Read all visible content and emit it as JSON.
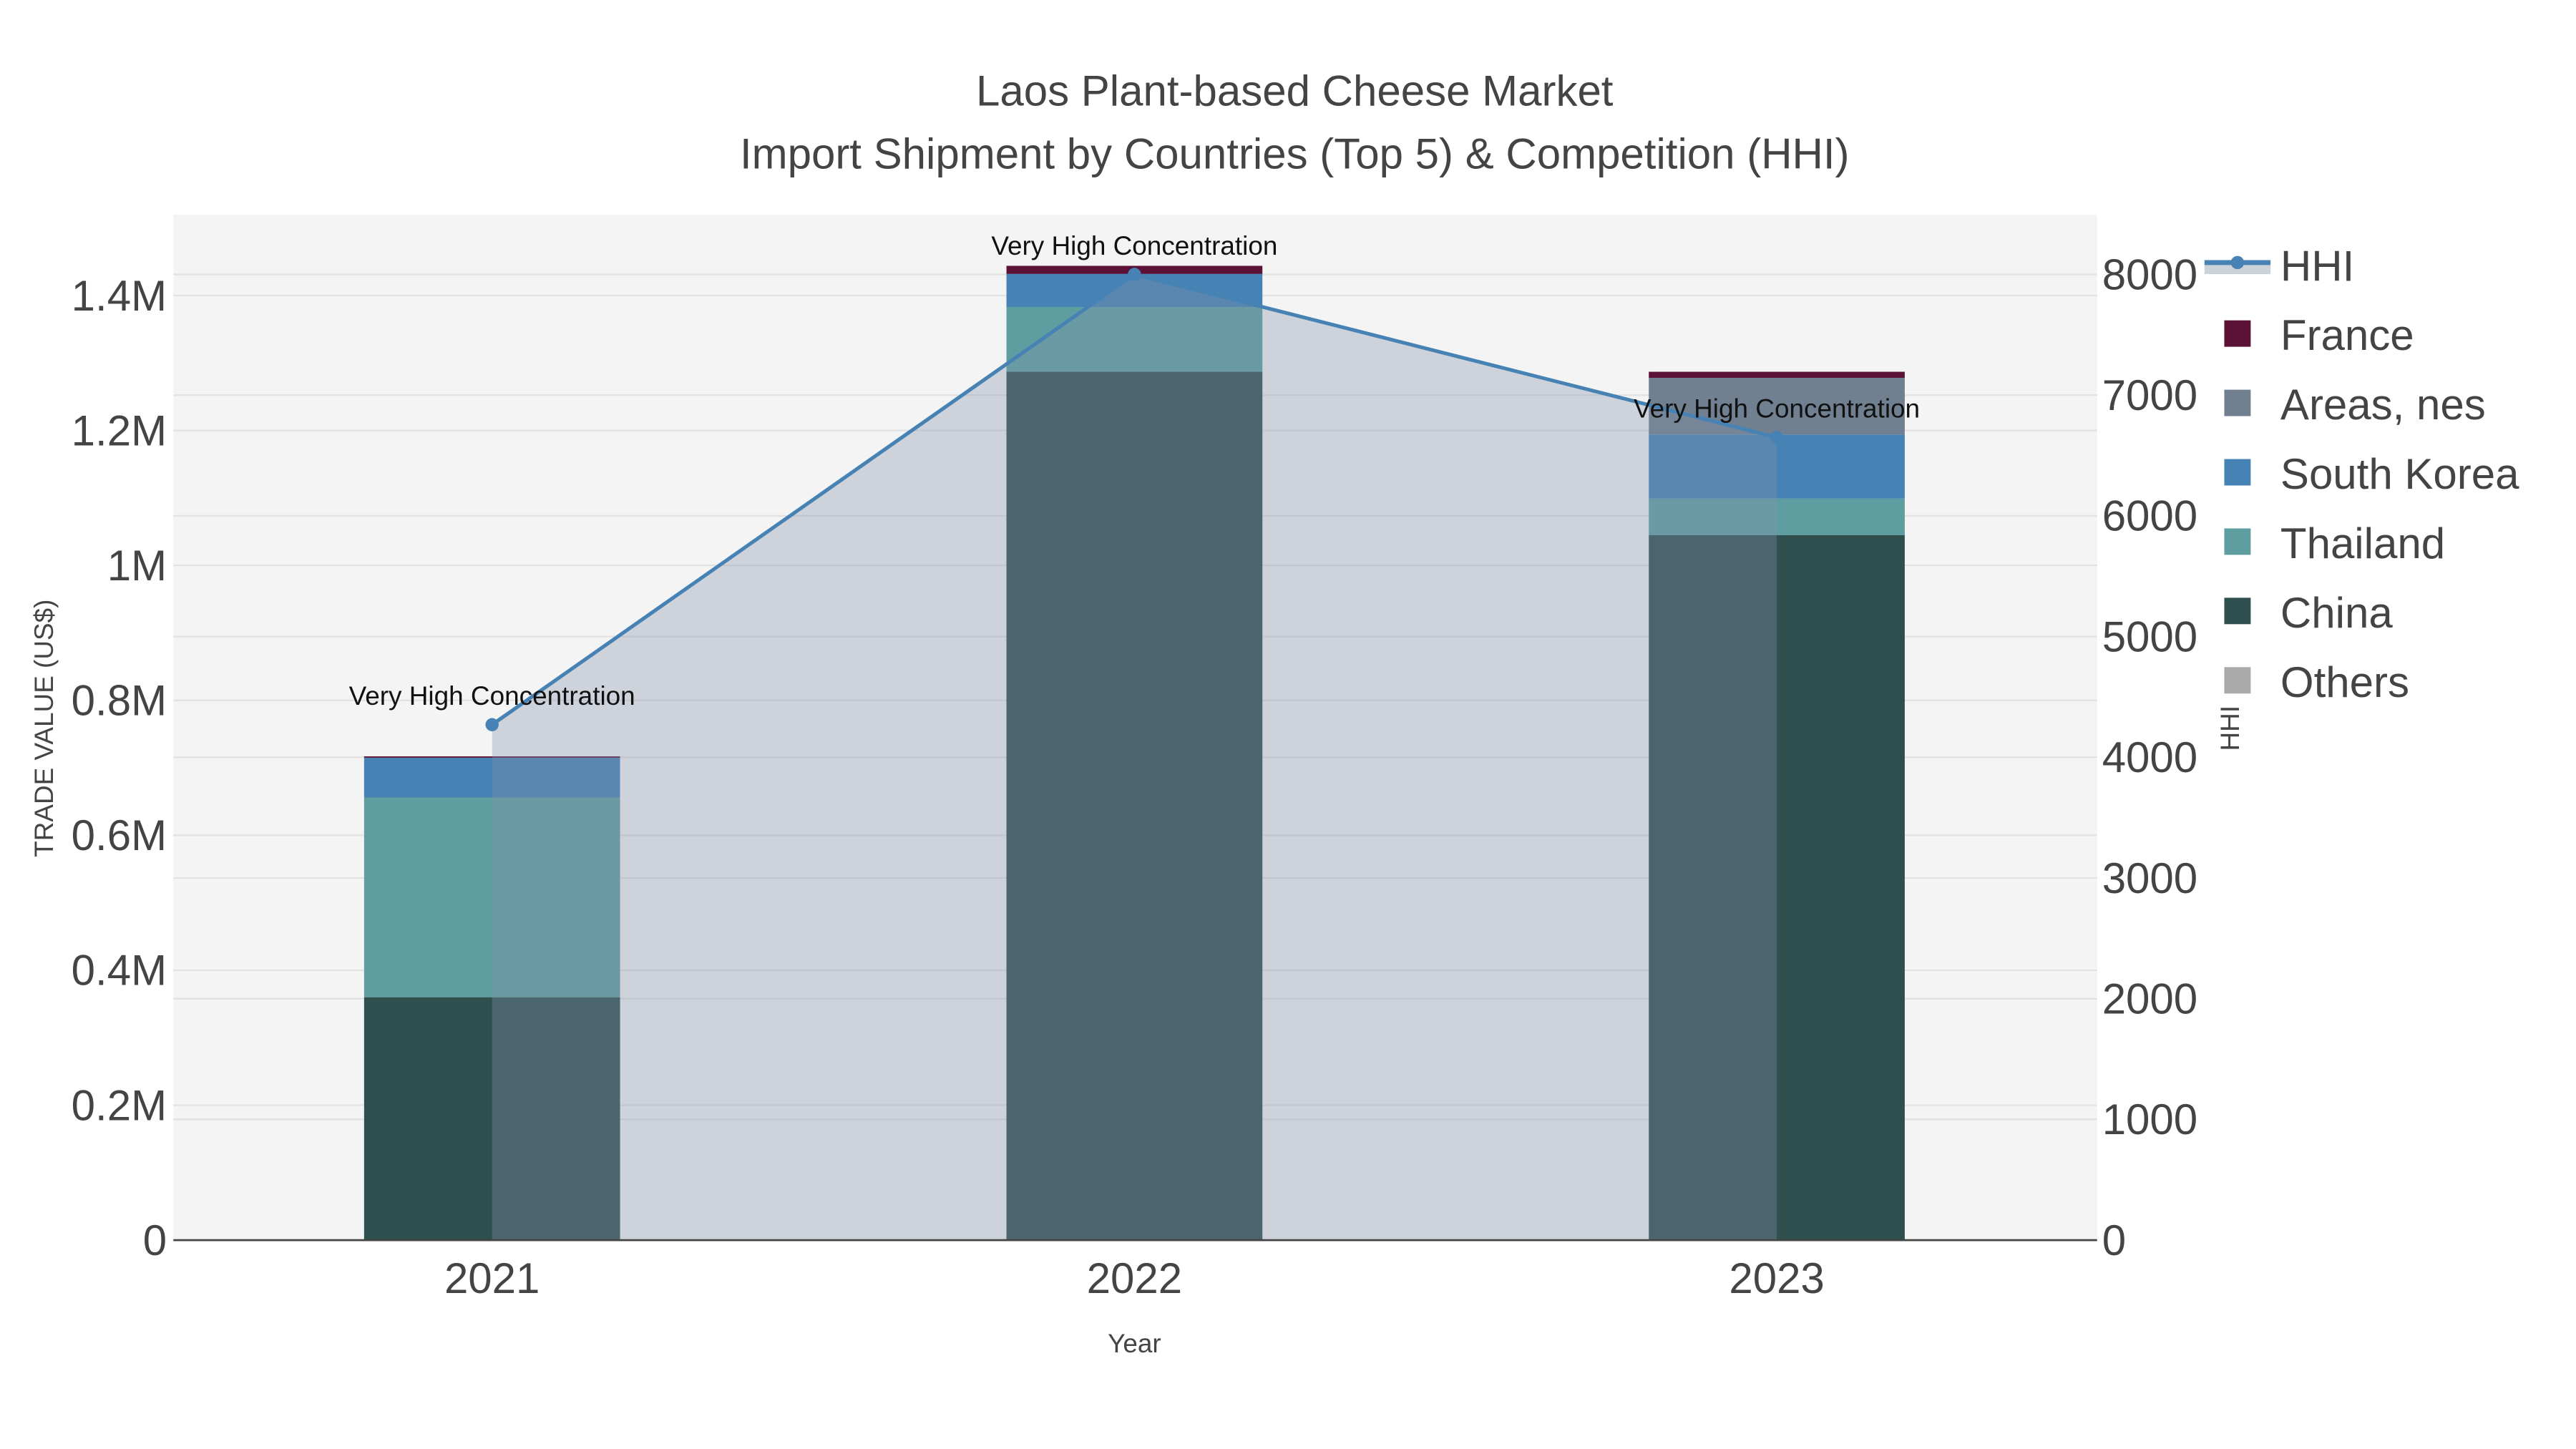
{
  "chart_data": {
    "type": "bar",
    "stacked": true,
    "title_line1": "Laos Plant-based Cheese Market",
    "title_line2": "Import Shipment by Countries (Top 5) & Competition (HHI)",
    "xlabel": "Year",
    "ylabel": "TRADE VALUE (US$)",
    "y2label": "HHI",
    "categories": [
      "2021",
      "2022",
      "2023"
    ],
    "ylim": [
      0,
      1520000
    ],
    "y2lim": [
      0,
      8500
    ],
    "yticks": [
      0,
      200000,
      400000,
      600000,
      800000,
      1000000,
      1200000,
      1400000
    ],
    "ytick_labels": [
      "0",
      "0.2M",
      "0.4M",
      "0.6M",
      "0.8M",
      "1M",
      "1.2M",
      "1.4M"
    ],
    "y2ticks": [
      0,
      1000,
      2000,
      3000,
      4000,
      5000,
      6000,
      7000,
      8000
    ],
    "y2tick_labels": [
      "0",
      "1000",
      "2000",
      "3000",
      "4000",
      "5000",
      "6000",
      "7000",
      "8000"
    ],
    "series": [
      {
        "name": "China",
        "color": "#2f4f4f",
        "values": [
          360000,
          1287000,
          1045000
        ]
      },
      {
        "name": "Thailand",
        "color": "#5f9ea0",
        "values": [
          296000,
          96000,
          54000
        ]
      },
      {
        "name": "South Korea",
        "color": "#4682b4",
        "values": [
          59000,
          49000,
          95000
        ]
      },
      {
        "name": "Areas, nes",
        "color": "#708090",
        "values": [
          0,
          0,
          84000
        ]
      },
      {
        "name": "France",
        "color": "#5c1236",
        "values": [
          2000,
          12000,
          9000
        ]
      },
      {
        "name": "Others",
        "color": "#aaaaaa",
        "values": [
          0,
          0,
          0
        ]
      }
    ],
    "hhi": {
      "name": "HHI",
      "color": "#4682b4",
      "values": [
        4270,
        8000,
        6650
      ],
      "annotations": [
        "Very High Concentration",
        "Very High Concentration",
        "Very High Concentration"
      ]
    },
    "legend": {
      "placement": "right",
      "items": [
        "HHI",
        "France",
        "Areas, nes",
        "South Korea",
        "Thailand",
        "China",
        "Others"
      ]
    },
    "grid": true
  }
}
